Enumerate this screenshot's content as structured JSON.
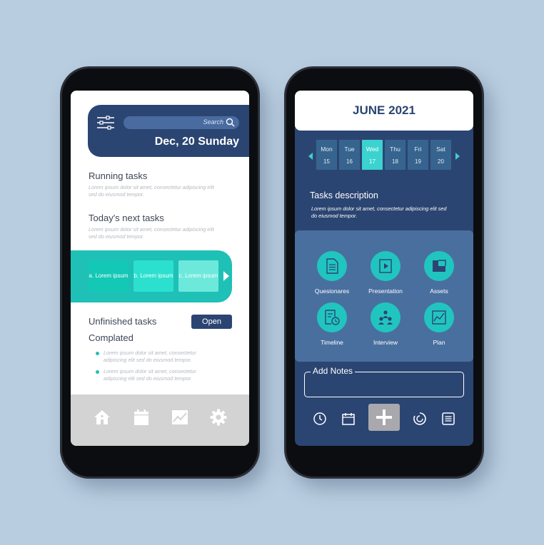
{
  "left_phone": {
    "search": {
      "placeholder": "Search"
    },
    "date": "Dec, 20 Sunday",
    "sections": {
      "running": {
        "title": "Running tasks",
        "text": "Lorem ipsum dolor sit amet, consectetur adipiscing elit sed do eiusmod tempor."
      },
      "next": {
        "title": "Today's next tasks",
        "text": "Lorem ipsum dolor sit amet, consectetur adipiscing elit sed do eiusmod tempor."
      }
    },
    "task_cards": [
      {
        "label": "a. Lorem ipsum"
      },
      {
        "label": "b. Lorem ipsum"
      },
      {
        "label": "c. Lorem ipsum"
      }
    ],
    "unfinished": {
      "title": "Unfinished tasks",
      "button": "Open"
    },
    "completed": {
      "title": "Complated",
      "items": [
        "Lorem ipsum dolor sit amet, consectetur adipiscing elit sed do eiusmod tempor.",
        "Lorem ipsum dolor sit amet, consectetur adipiscing elit sed do eiusmod tempor."
      ]
    },
    "bottom_nav": [
      "home-icon",
      "calendar-icon",
      "chart-icon",
      "gear-icon"
    ]
  },
  "right_phone": {
    "month": "JUNE 2021",
    "days": [
      {
        "name": "Mon",
        "date": "15"
      },
      {
        "name": "Tue",
        "date": "16"
      },
      {
        "name": "Wed",
        "date": "17",
        "active": true
      },
      {
        "name": "Thu",
        "date": "18"
      },
      {
        "name": "Fri",
        "date": "19"
      },
      {
        "name": "Sat",
        "date": "20"
      }
    ],
    "tasks_description": {
      "title": "Tasks description",
      "text": "Lorem ipsum dolor sit amet, consectetur adipiscing elit sed do eiusmod tempor."
    },
    "tiles": [
      {
        "label": "Quesionares",
        "icon": "document-icon"
      },
      {
        "label": "Presentation",
        "icon": "presentation-icon"
      },
      {
        "label": "Assets",
        "icon": "folder-icon"
      },
      {
        "label": "Timeline",
        "icon": "timeline-icon"
      },
      {
        "label": "Interview",
        "icon": "people-icon"
      },
      {
        "label": "Plan",
        "icon": "chart-icon"
      }
    ],
    "notes": {
      "label": "Add Notes"
    },
    "bottom_nav": [
      "clock-icon",
      "calendar-icon",
      "plus-icon",
      "refresh-icon",
      "list-icon"
    ]
  },
  "colors": {
    "background": "#b9cde0",
    "navy": "#2b4572",
    "teal": "#1fc0b6",
    "panel": "#496f9f",
    "nav_gray": "#d3d3d3"
  }
}
